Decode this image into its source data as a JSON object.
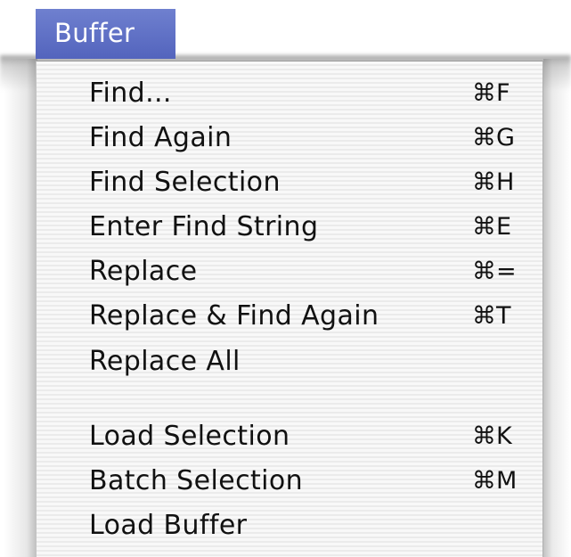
{
  "menu": {
    "title": "Buffer",
    "items": [
      {
        "label": "Find...",
        "shortcut": "⌘F"
      },
      {
        "label": "Find Again",
        "shortcut": "⌘G"
      },
      {
        "label": "Find Selection",
        "shortcut": "⌘H"
      },
      {
        "label": "Enter Find String",
        "shortcut": "⌘E"
      },
      {
        "label": "Replace",
        "shortcut": "⌘="
      },
      {
        "label": "Replace & Find Again",
        "shortcut": "⌘T"
      },
      {
        "label": "Replace All",
        "shortcut": ""
      },
      {
        "label": "Load Selection",
        "shortcut": "⌘K"
      },
      {
        "label": "Batch Selection",
        "shortcut": "⌘M"
      },
      {
        "label": "Load Buffer",
        "shortcut": ""
      }
    ]
  },
  "colors": {
    "title_background": "#5f70c6",
    "title_text": "#ffffff",
    "menu_background": "#f6f6f6",
    "menu_text": "#111111"
  }
}
